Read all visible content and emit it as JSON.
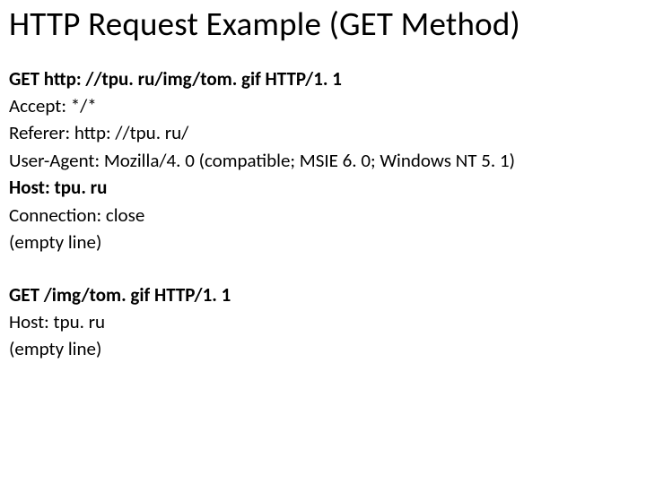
{
  "title": "HTTP Request Example (GET Method)",
  "block1": {
    "l1": "GET http: //tpu. ru/img/tom. gif HTTP/1. 1",
    "l2": "Accept: */*",
    "l3": "Referer: http: //tpu. ru/",
    "l4": "User-Agent: Mozilla/4. 0 (compatible; MSIE 6. 0; Windows NT 5. 1)",
    "l5": "Host: tpu. ru",
    "l6": "Connection: close",
    "l7": "(empty line)"
  },
  "block2": {
    "l1": "GET /img/tom. gif HTTP/1. 1",
    "l2": "Host: tpu. ru",
    "l3": "(empty line)"
  }
}
